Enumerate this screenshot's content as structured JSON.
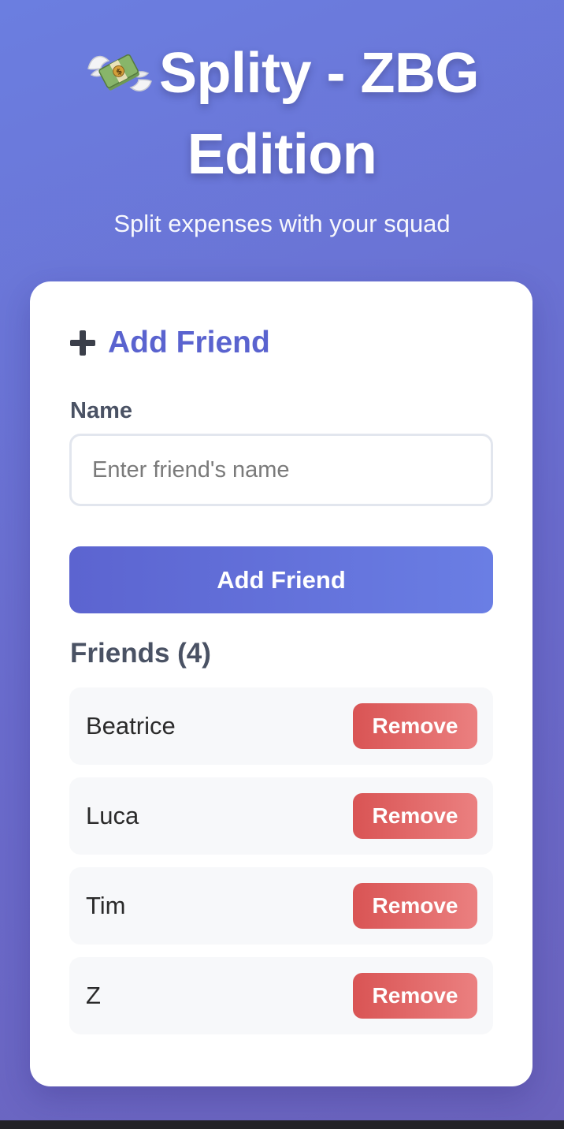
{
  "header": {
    "title": "Splity - ZBG Edition",
    "subtitle": "Split expenses with your squad",
    "logo_icon": "money-with-wings-icon"
  },
  "add_friend": {
    "section_title": "Add Friend",
    "section_icon": "plus-icon",
    "name_label": "Name",
    "name_value": "",
    "name_placeholder": "Enter friend's name",
    "submit_label": "Add Friend"
  },
  "friends": {
    "heading": "Friends (4)",
    "items": [
      {
        "name": "Beatrice",
        "remove_label": "Remove"
      },
      {
        "name": "Luca",
        "remove_label": "Remove"
      },
      {
        "name": "Tim",
        "remove_label": "Remove"
      },
      {
        "name": "Z",
        "remove_label": "Remove"
      }
    ]
  },
  "colors": {
    "background_start": "#6b7ee0",
    "background_end": "#6b63bd",
    "accent": "#5a63cf",
    "danger_start": "#d95454",
    "danger_end": "#eb8080",
    "card": "#ffffff",
    "row": "#f7f8fa"
  }
}
